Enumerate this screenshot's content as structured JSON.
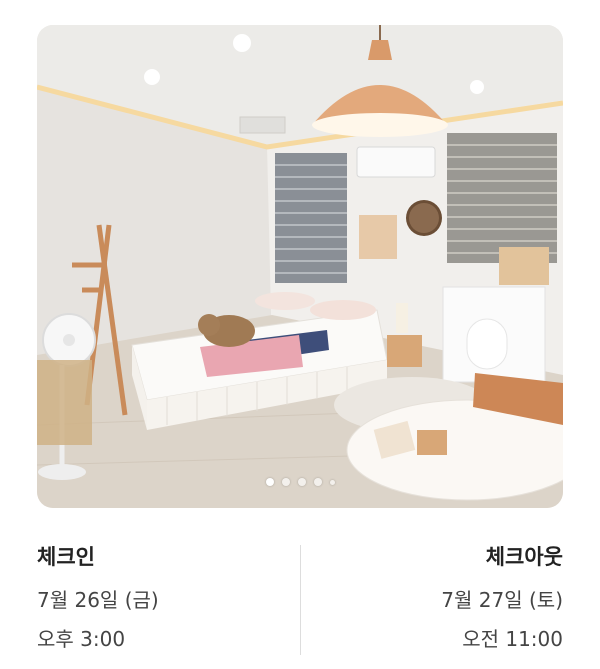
{
  "photo": {
    "alt": "Room photo with bed, lamp and table",
    "carousel": {
      "count": 5,
      "active_index": 0
    }
  },
  "checkin": {
    "label": "체크인",
    "date": "7월 26일 (금)",
    "time": "오후 3:00"
  },
  "checkout": {
    "label": "체크아웃",
    "date": "7월 27일 (토)",
    "time": "오전 11:00"
  }
}
